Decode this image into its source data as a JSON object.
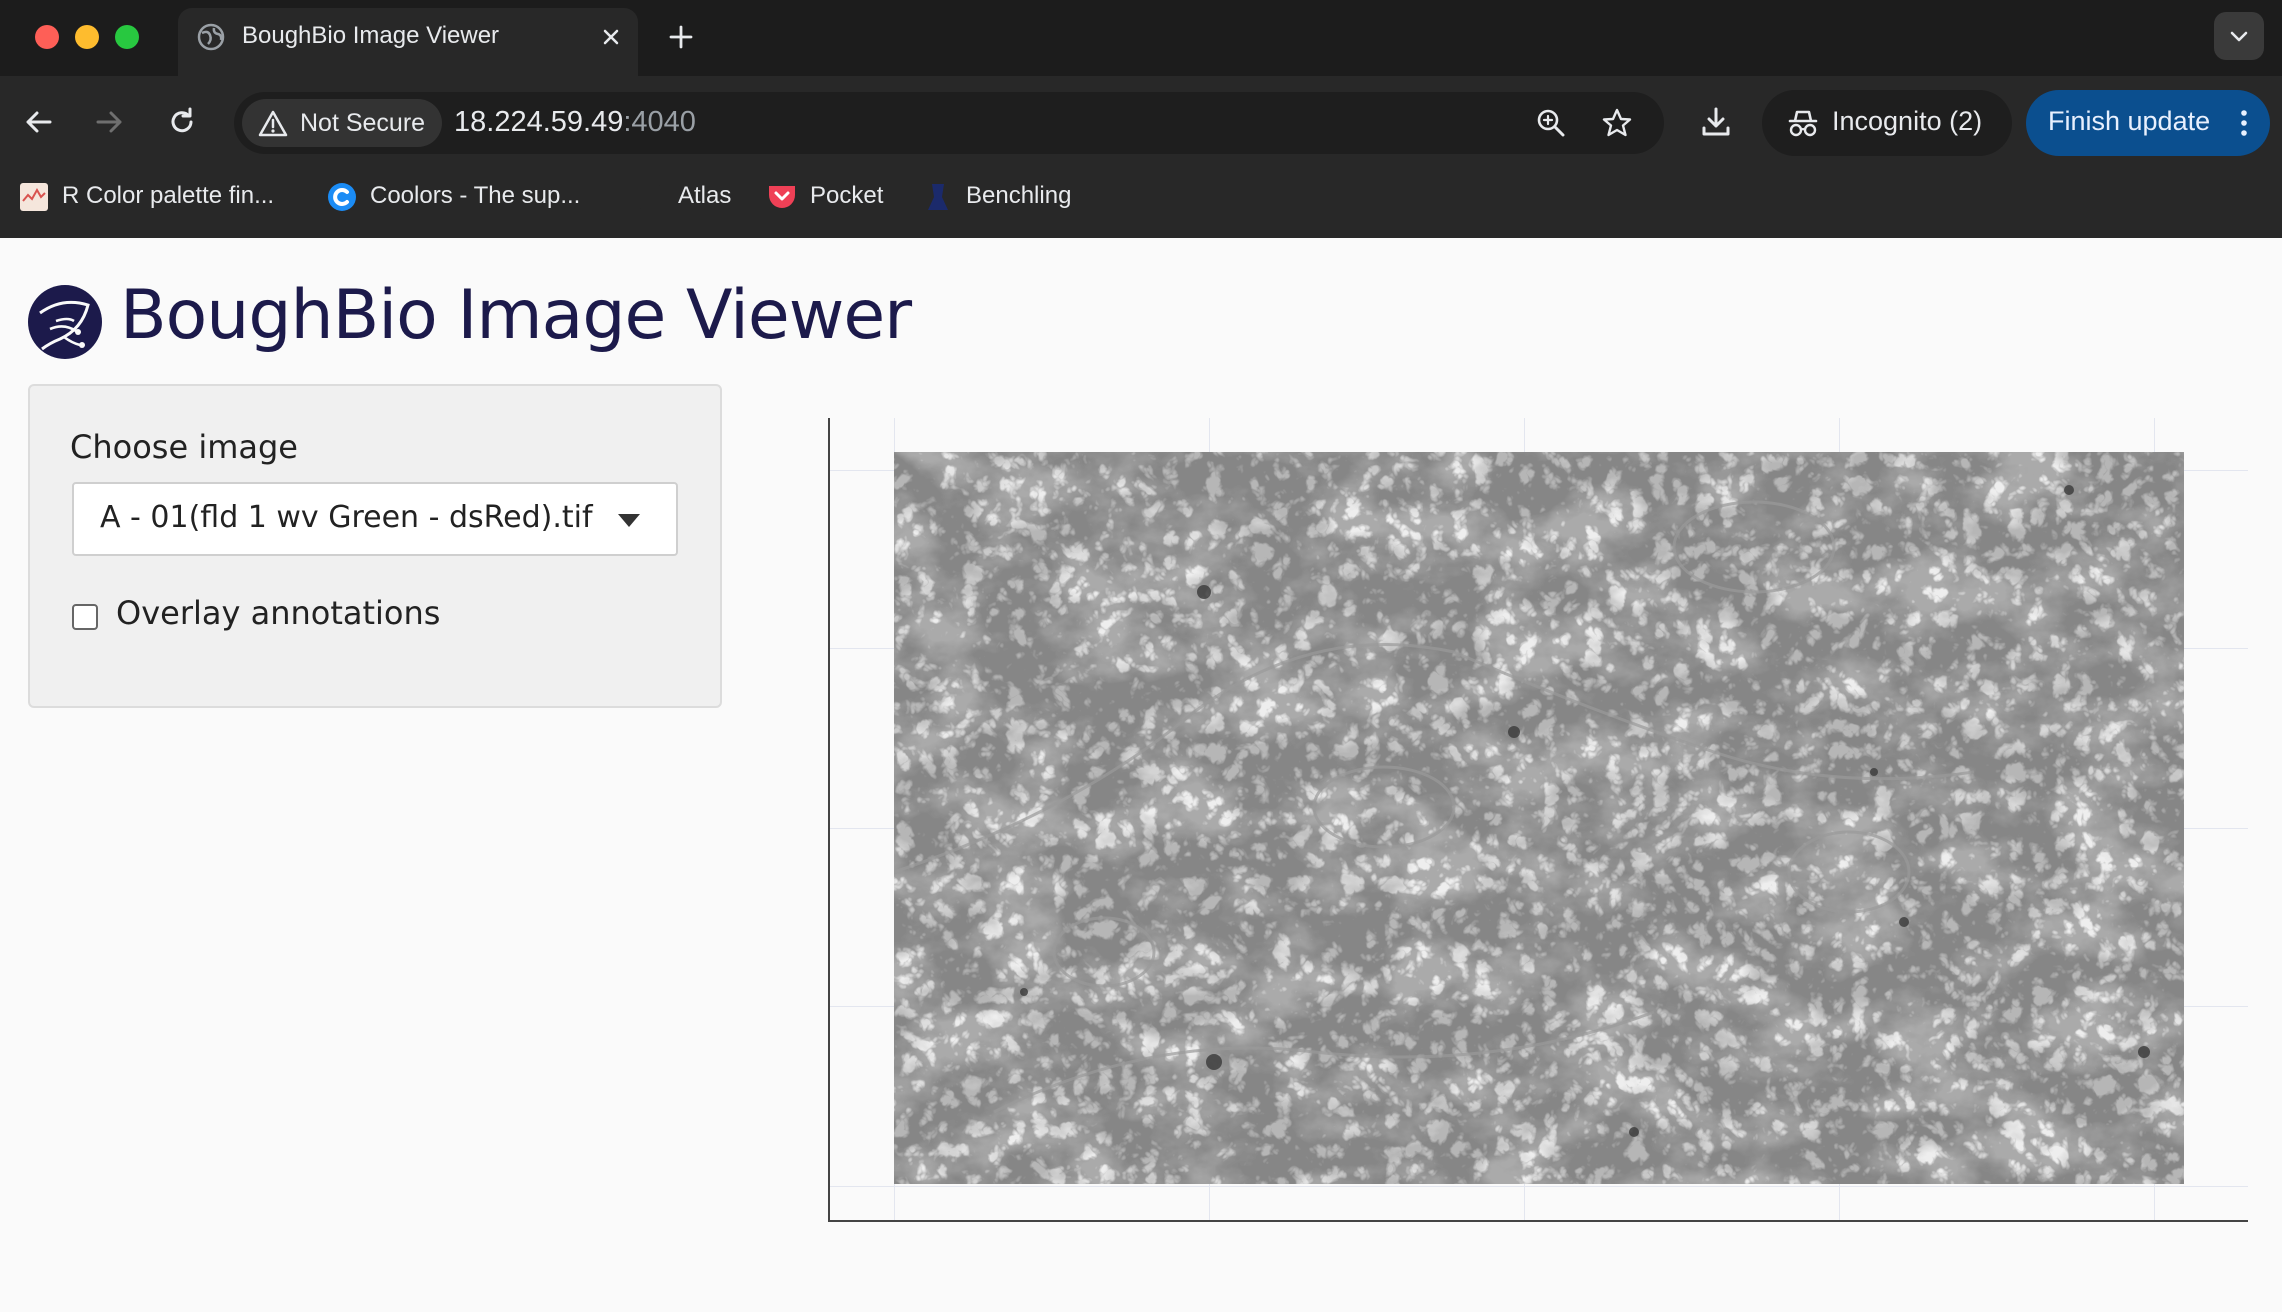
{
  "browser": {
    "tab_title": "BoughBio Image Viewer",
    "security_label": "Not Secure",
    "url_host": "18.224.59.49",
    "url_port": ":4040",
    "incognito_label": "Incognito (2)",
    "finish_update_label": "Finish update",
    "bookmarks": [
      {
        "label": "R Color palette fin...",
        "icon": "r-palette-icon"
      },
      {
        "label": "Coolors - The sup...",
        "icon": "coolors-icon"
      },
      {
        "label": "Atlas",
        "icon": "atlas-icon"
      },
      {
        "label": "Pocket",
        "icon": "pocket-icon"
      },
      {
        "label": "Benchling",
        "icon": "benchling-icon"
      }
    ]
  },
  "app": {
    "title": "BoughBio Image Viewer",
    "sidebar": {
      "choose_image_label": "Choose image",
      "selected_image": "A - 01(fld 1 wv Green - dsRed).tif",
      "overlay_label": "Overlay annotations",
      "overlay_checked": false
    }
  },
  "colors": {
    "title": "#1c1a4b",
    "finish_update_bg": "#0b4f8f",
    "chrome_bg": "#282828"
  }
}
